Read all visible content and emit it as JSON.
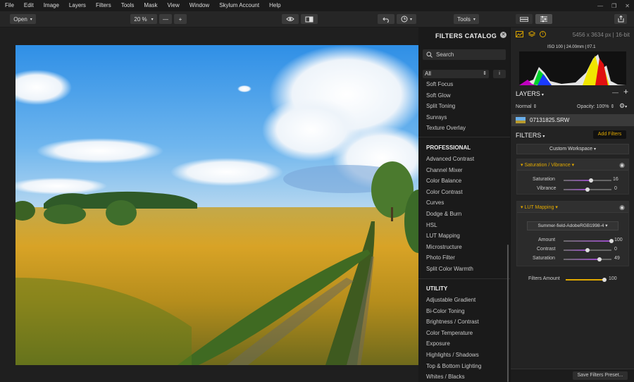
{
  "menu": [
    "File",
    "Edit",
    "Image",
    "Layers",
    "Filters",
    "Tools",
    "Mask",
    "View",
    "Window",
    "Skylum Account",
    "Help"
  ],
  "toolbar": {
    "open_label": "Open",
    "zoom_value": "20 %",
    "zoom_out": "—",
    "zoom_in": "+",
    "tools_label": "Tools"
  },
  "catalog": {
    "title": "FILTERS CATALOG",
    "search_placeholder": "Search",
    "category": "All",
    "items_top": [
      "Soft Focus",
      "Soft Glow",
      "Split Toning",
      "Sunrays",
      "Texture Overlay"
    ],
    "professional_header": "PROFESSIONAL",
    "professional": [
      "Advanced Contrast",
      "Channel Mixer",
      "Color Balance",
      "Color Contrast",
      "Curves",
      "Dodge & Burn",
      "HSL",
      "LUT Mapping",
      "Microstructure",
      "Photo Filter",
      "Split Color Warmth"
    ],
    "utility_header": "UTILITY",
    "utility": [
      "Adjustable Gradient",
      "Bi-Color Toning",
      "Brightness / Contrast",
      "Color Temperature",
      "Exposure",
      "Highlights / Shadows",
      "Top & Bottom Lighting",
      "Whites / Blacks"
    ]
  },
  "info": {
    "dimensions": "5456 x 3634 px",
    "bitdepth": "16-bit",
    "exif": "ISO 100  |  24.00mm  |  f/7.1"
  },
  "layers": {
    "title": "LAYERS",
    "blend": "Normal",
    "opacity": "Opacity: 100%",
    "layer_name": "07131825.SRW"
  },
  "filters": {
    "title": "FILTERS",
    "add_label": "Add Filters",
    "workspace": "Custom Workspace",
    "sat_vib": {
      "title": "Saturation / Vibrance",
      "saturation_label": "Saturation",
      "saturation": "16",
      "saturation_pct": 0.58,
      "vibrance_label": "Vibrance",
      "vibrance": "0",
      "vibrance_pct": 0.5
    },
    "lut": {
      "title": "LUT Mapping",
      "preset": "Summer-field-AdobeRGB1998-4",
      "amount_label": "Amount",
      "amount": "100",
      "amount_pct": 1.0,
      "contrast_label": "Contrast",
      "contrast": "0",
      "contrast_pct": 0.5,
      "saturation_label": "Saturation",
      "saturation": "49",
      "saturation_pct": 0.745
    },
    "amount_label": "Filters Amount",
    "amount": "100",
    "amount_pct": 1.0,
    "save_label": "Save Filters Preset..."
  }
}
